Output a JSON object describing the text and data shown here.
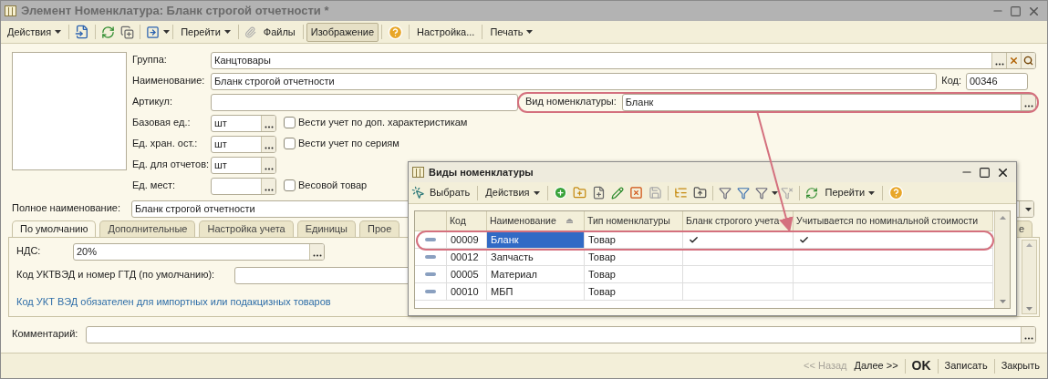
{
  "window": {
    "title": "Элемент Номенклатура: Бланк строгой отчетности *"
  },
  "toolbar": {
    "actions": {
      "label": "Действия"
    },
    "goto": {
      "label": "Перейти"
    },
    "files": {
      "label": "Файлы"
    },
    "image": {
      "label": "Изображение",
      "pressed": true
    },
    "settings": {
      "label": "Настройка..."
    },
    "print": {
      "label": "Печать"
    }
  },
  "group": {
    "label": "Группа:",
    "value": "Канцтовары"
  },
  "name": {
    "label": "Наименование:",
    "value": "Бланк строгой отчетности"
  },
  "code": {
    "label": "Код:",
    "value": "00346"
  },
  "article": {
    "label": "Артикул:"
  },
  "item_kind": {
    "label": "Вид номенклатуры:",
    "value": "Бланк"
  },
  "units": [
    {
      "label": "Базовая ед.:",
      "value": "шт",
      "checkbox": {
        "label": "Вести учет по доп. характеристикам",
        "checked": false
      }
    },
    {
      "label": "Ед. хран. ост.:",
      "value": "шт",
      "checkbox": {
        "label": "Вести учет по сериям",
        "checked": false
      }
    },
    {
      "label": "Ед. для отчетов:",
      "value": "шт"
    },
    {
      "label": "Ед. мест:",
      "checkbox": {
        "label": "Весовой товар",
        "checked": false
      }
    }
  ],
  "full_name": {
    "label": "Полное наименование:",
    "value": "Бланк строгой отчетности"
  },
  "tabs": [
    {
      "label": "По умолчанию",
      "selected": true
    },
    {
      "label": "Дополнительные",
      "selected": false
    },
    {
      "label": "Настройка учета",
      "selected": false
    },
    {
      "label": "Единицы",
      "selected": false
    },
    {
      "label": "Прое",
      "selected": false
    },
    {
      "label": "е",
      "selected": false
    }
  ],
  "vat": {
    "label": "НДС:",
    "value": "20%"
  },
  "customs_code": {
    "label": "Код УКТВЭД и номер ГТД (по умолчанию):"
  },
  "customs_note": "Код УКТ ВЭД обязателен для импортных или подакцизных товаров",
  "comment": {
    "label": "Комментарий:"
  },
  "buttons": [
    {
      "label": "<< Назад",
      "disabled": true,
      "default": false
    },
    {
      "label": "Далее >>",
      "disabled": false,
      "default": false
    },
    {
      "label": "OK",
      "disabled": false,
      "default": true
    },
    {
      "label": "Записать",
      "disabled": false,
      "default": false
    },
    {
      "label": "Закрыть",
      "disabled": false,
      "default": false
    }
  ],
  "list": {
    "title": "Виды номенклатуры",
    "toolbar": {
      "select": {
        "label": "Выбрать"
      },
      "actions": {
        "label": "Действия"
      },
      "goto": {
        "label": "Перейти"
      }
    },
    "columns": [
      "Код",
      "Наименование",
      "Тип номенклатуры",
      "Бланк строгого учета",
      "Учитывается по номинальной стоимости"
    ],
    "rows": [
      {
        "code": "00009",
        "name": "Бланк",
        "type": "Товар",
        "strict": true,
        "nominal": true,
        "selected": true
      },
      {
        "code": "00012",
        "name": "Запчасть",
        "type": "Товар",
        "strict": false,
        "nominal": false,
        "selected": false
      },
      {
        "code": "00005",
        "name": "Материал",
        "type": "Товар",
        "strict": false,
        "nominal": false,
        "selected": false
      },
      {
        "code": "00010",
        "name": "МБП",
        "type": "Товар",
        "strict": false,
        "nominal": false,
        "selected": false
      }
    ]
  }
}
